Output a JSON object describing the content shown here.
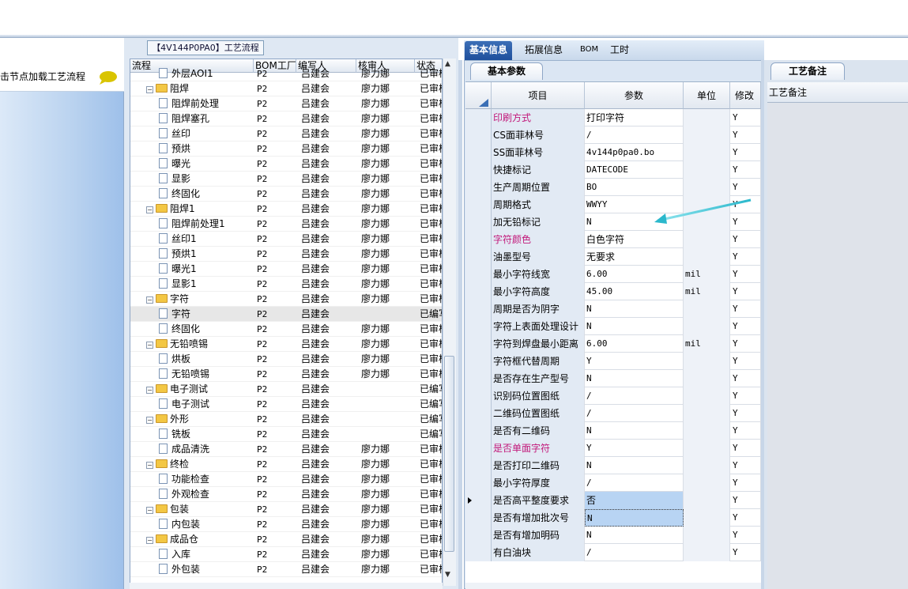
{
  "left_panel": {
    "hint": "击节点加载工艺流程"
  },
  "flow_tab": {
    "label": "【4V144P0PA0】工艺流程"
  },
  "tree_grid": {
    "columns": [
      "流程",
      "BOM工厂",
      "编写人",
      "核审人",
      "状态"
    ],
    "rows": [
      {
        "name": "外层AOI1",
        "level": 2,
        "kind": "doc",
        "factory": "P2",
        "writer": "吕建会",
        "reviewer": "廖力娜",
        "status": "已审核"
      },
      {
        "name": "阻焊",
        "level": 1,
        "kind": "folder",
        "factory": "P2",
        "writer": "吕建会",
        "reviewer": "廖力娜",
        "status": "已审核"
      },
      {
        "name": "阻焊前处理",
        "level": 2,
        "kind": "doc",
        "factory": "P2",
        "writer": "吕建会",
        "reviewer": "廖力娜",
        "status": "已审核"
      },
      {
        "name": "阻焊塞孔",
        "level": 2,
        "kind": "doc",
        "factory": "P2",
        "writer": "吕建会",
        "reviewer": "廖力娜",
        "status": "已审核"
      },
      {
        "name": "丝印",
        "level": 2,
        "kind": "doc",
        "factory": "P2",
        "writer": "吕建会",
        "reviewer": "廖力娜",
        "status": "已审核"
      },
      {
        "name": "预烘",
        "level": 2,
        "kind": "doc",
        "factory": "P2",
        "writer": "吕建会",
        "reviewer": "廖力娜",
        "status": "已审核"
      },
      {
        "name": "曝光",
        "level": 2,
        "kind": "doc",
        "factory": "P2",
        "writer": "吕建会",
        "reviewer": "廖力娜",
        "status": "已审核"
      },
      {
        "name": "显影",
        "level": 2,
        "kind": "doc",
        "factory": "P2",
        "writer": "吕建会",
        "reviewer": "廖力娜",
        "status": "已审核"
      },
      {
        "name": "终固化",
        "level": 2,
        "kind": "doc",
        "factory": "P2",
        "writer": "吕建会",
        "reviewer": "廖力娜",
        "status": "已审核"
      },
      {
        "name": "阻焊1",
        "level": 1,
        "kind": "folder",
        "factory": "P2",
        "writer": "吕建会",
        "reviewer": "廖力娜",
        "status": "已审核"
      },
      {
        "name": "阻焊前处理1",
        "level": 2,
        "kind": "doc",
        "factory": "P2",
        "writer": "吕建会",
        "reviewer": "廖力娜",
        "status": "已审核"
      },
      {
        "name": "丝印1",
        "level": 2,
        "kind": "doc",
        "factory": "P2",
        "writer": "吕建会",
        "reviewer": "廖力娜",
        "status": "已审核"
      },
      {
        "name": "预烘1",
        "level": 2,
        "kind": "doc",
        "factory": "P2",
        "writer": "吕建会",
        "reviewer": "廖力娜",
        "status": "已审核"
      },
      {
        "name": "曝光1",
        "level": 2,
        "kind": "doc",
        "factory": "P2",
        "writer": "吕建会",
        "reviewer": "廖力娜",
        "status": "已审核"
      },
      {
        "name": "显影1",
        "level": 2,
        "kind": "doc",
        "factory": "P2",
        "writer": "吕建会",
        "reviewer": "廖力娜",
        "status": "已审核"
      },
      {
        "name": "字符",
        "level": 1,
        "kind": "folder",
        "factory": "P2",
        "writer": "吕建会",
        "reviewer": "廖力娜",
        "status": "已审核"
      },
      {
        "name": "字符",
        "level": 2,
        "kind": "doc",
        "factory": "P2",
        "writer": "吕建会",
        "reviewer": "",
        "status": "已编写",
        "selected": true
      },
      {
        "name": "终固化",
        "level": 2,
        "kind": "doc",
        "factory": "P2",
        "writer": "吕建会",
        "reviewer": "廖力娜",
        "status": "已审核"
      },
      {
        "name": "无铅喷锡",
        "level": 1,
        "kind": "folder",
        "factory": "P2",
        "writer": "吕建会",
        "reviewer": "廖力娜",
        "status": "已审核"
      },
      {
        "name": "烘板",
        "level": 2,
        "kind": "doc",
        "factory": "P2",
        "writer": "吕建会",
        "reviewer": "廖力娜",
        "status": "已审核"
      },
      {
        "name": "无铅喷锡",
        "level": 2,
        "kind": "doc",
        "factory": "P2",
        "writer": "吕建会",
        "reviewer": "廖力娜",
        "status": "已审核"
      },
      {
        "name": "电子测试",
        "level": 1,
        "kind": "folder",
        "factory": "P2",
        "writer": "吕建会",
        "reviewer": "",
        "status": "已编写"
      },
      {
        "name": "电子测试",
        "level": 2,
        "kind": "doc",
        "factory": "P2",
        "writer": "吕建会",
        "reviewer": "",
        "status": "已编写"
      },
      {
        "name": "外形",
        "level": 1,
        "kind": "folder",
        "factory": "P2",
        "writer": "吕建会",
        "reviewer": "",
        "status": "已编写"
      },
      {
        "name": "铣板",
        "level": 2,
        "kind": "doc",
        "factory": "P2",
        "writer": "吕建会",
        "reviewer": "",
        "status": "已编写"
      },
      {
        "name": "成品清洗",
        "level": 2,
        "kind": "doc",
        "factory": "P2",
        "writer": "吕建会",
        "reviewer": "廖力娜",
        "status": "已审核"
      },
      {
        "name": "终检",
        "level": 1,
        "kind": "folder",
        "factory": "P2",
        "writer": "吕建会",
        "reviewer": "廖力娜",
        "status": "已审核"
      },
      {
        "name": "功能检查",
        "level": 2,
        "kind": "doc",
        "factory": "P2",
        "writer": "吕建会",
        "reviewer": "廖力娜",
        "status": "已审核"
      },
      {
        "name": "外观检查",
        "level": 2,
        "kind": "doc",
        "factory": "P2",
        "writer": "吕建会",
        "reviewer": "廖力娜",
        "status": "已审核"
      },
      {
        "name": "包装",
        "level": 1,
        "kind": "folder",
        "factory": "P2",
        "writer": "吕建会",
        "reviewer": "廖力娜",
        "status": "已审核"
      },
      {
        "name": "内包装",
        "level": 2,
        "kind": "doc",
        "factory": "P2",
        "writer": "吕建会",
        "reviewer": "廖力娜",
        "status": "已审核"
      },
      {
        "name": "成品仓",
        "level": 1,
        "kind": "folder",
        "factory": "P2",
        "writer": "吕建会",
        "reviewer": "廖力娜",
        "status": "已审核"
      },
      {
        "name": "入库",
        "level": 2,
        "kind": "doc",
        "factory": "P2",
        "writer": "吕建会",
        "reviewer": "廖力娜",
        "status": "已审核"
      },
      {
        "name": "外包装",
        "level": 2,
        "kind": "doc",
        "factory": "P2",
        "writer": "吕建会",
        "reviewer": "廖力娜",
        "status": "已审核"
      }
    ]
  },
  "right_tabs": [
    "基本信息",
    "拓展信息",
    "BOM",
    "工时"
  ],
  "params": {
    "subtab": "基本参数",
    "columns": [
      "项目",
      "参数",
      "单位",
      "修改"
    ],
    "rows": [
      {
        "item": "印刷方式",
        "value": "打印字符",
        "unit": "",
        "mod": "Y",
        "pink": true
      },
      {
        "item": "CS面菲林号",
        "value": "/",
        "unit": "",
        "mod": "Y"
      },
      {
        "item": "SS面菲林号",
        "value": "4v144p0pa0.bo",
        "unit": "",
        "mod": "Y"
      },
      {
        "item": "快捷标记",
        "value": "DATECODE",
        "unit": "",
        "mod": "Y"
      },
      {
        "item": "生产周期位置",
        "value": "BO",
        "unit": "",
        "mod": "Y"
      },
      {
        "item": "周期格式",
        "value": "WWYY",
        "unit": "",
        "mod": "Y"
      },
      {
        "item": "加无铅标记",
        "value": "N",
        "unit": "",
        "mod": "Y"
      },
      {
        "item": "字符颜色",
        "value": "白色字符",
        "unit": "",
        "mod": "Y",
        "pink": true
      },
      {
        "item": "油墨型号",
        "value": "无要求",
        "unit": "",
        "mod": "Y"
      },
      {
        "item": "最小字符线宽",
        "value": "6.00",
        "unit": "mil",
        "mod": "Y"
      },
      {
        "item": "最小字符高度",
        "value": "45.00",
        "unit": "mil",
        "mod": "Y"
      },
      {
        "item": "周期是否为阴字",
        "value": "N",
        "unit": "",
        "mod": "Y"
      },
      {
        "item": "字符上表面处理设计",
        "value": "N",
        "unit": "",
        "mod": "Y"
      },
      {
        "item": "字符到焊盘最小距离",
        "value": "6.00",
        "unit": "mil",
        "mod": "Y"
      },
      {
        "item": "字符框代替周期",
        "value": "Y",
        "unit": "",
        "mod": "Y"
      },
      {
        "item": "是否存在生产型号",
        "value": "N",
        "unit": "",
        "mod": "Y"
      },
      {
        "item": "识别码位置图纸",
        "value": "/",
        "unit": "",
        "mod": "Y"
      },
      {
        "item": "二维码位置图纸",
        "value": "/",
        "unit": "",
        "mod": "Y"
      },
      {
        "item": "是否有二维码",
        "value": "N",
        "unit": "",
        "mod": "Y"
      },
      {
        "item": "是否单面字符",
        "value": "Y",
        "unit": "",
        "mod": "Y",
        "pink": true
      },
      {
        "item": "是否打印二维码",
        "value": "N",
        "unit": "",
        "mod": "Y"
      },
      {
        "item": "最小字符厚度",
        "value": "/",
        "unit": "",
        "mod": "Y"
      },
      {
        "item": "是否高平整度要求",
        "value": "否",
        "unit": "",
        "mod": "Y",
        "current": true
      },
      {
        "item": "是否有增加批次号",
        "value": "N",
        "unit": "",
        "mod": "Y",
        "focused": true
      },
      {
        "item": "是否有增加明码",
        "value": "N",
        "unit": "",
        "mod": "Y"
      },
      {
        "item": "有白油块",
        "value": "/",
        "unit": "",
        "mod": "Y"
      }
    ]
  },
  "notes": {
    "tab": "工艺备注",
    "header": "工艺备注"
  },
  "colors": {
    "accent": "#1e4f9c",
    "pink": "#c2187a",
    "arrow": "#3fc6d6"
  }
}
